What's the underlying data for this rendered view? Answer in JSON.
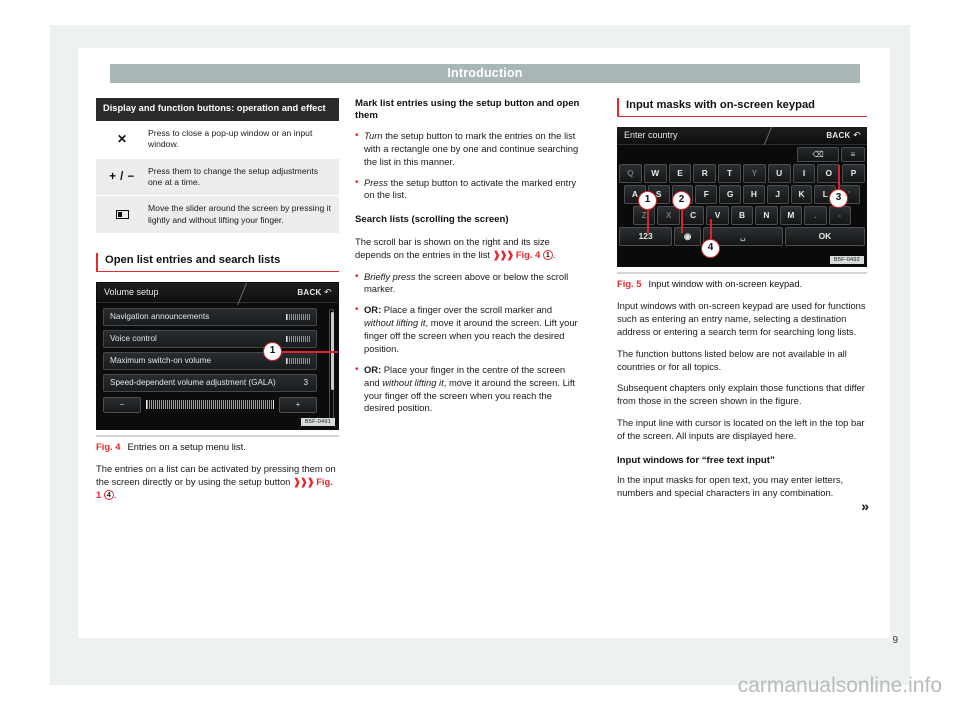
{
  "header": {
    "title": "Introduction"
  },
  "page": {
    "number": "9",
    "watermark": "carmanualsonline.info",
    "more_indicator": "»"
  },
  "col1": {
    "table": {
      "header": "Display and function buttons: operation and effect",
      "rows": [
        {
          "icon": "close-x-icon",
          "glyph": "✕",
          "text": "Press to close a pop-up window or an input window."
        },
        {
          "icon": "plus-minus-icon",
          "glyph": "+ / −",
          "text": "Press them to change the setup adjustments one at a time."
        },
        {
          "icon": "slider-icon",
          "glyph": "slider",
          "text": "Move the slider around the screen by pressing it lightly and without lifting your finger."
        }
      ]
    },
    "section_heading": "Open list entries and search lists",
    "figure": {
      "label": "Fig. 4",
      "caption": "Entries on a setup menu list.",
      "code": "B5F-0491",
      "screen": {
        "title": "Volume setup",
        "back": "BACK",
        "items": [
          {
            "label": "Navigation announcements",
            "value": ""
          },
          {
            "label": "Voice control",
            "value": ""
          },
          {
            "label": "Maximum switch-on volume",
            "value": ""
          },
          {
            "label": "Speed-dependent volume adjustment (GALA)",
            "value": "3"
          }
        ],
        "minus_button": "−",
        "plus_button": "+",
        "callout": "1"
      }
    },
    "paragraph": "The entries on a list can be activated by pressing them on the screen directly or by using the setup button ",
    "paragraph_xref": "Fig. 1",
    "paragraph_ref_num": "4",
    "paragraph_end": "."
  },
  "col2": {
    "heading_1": "Mark list entries using the setup button and open them",
    "bullets_1": [
      {
        "lead": "Turn",
        "lead_style": "italic",
        "rest": " the setup button to mark the entries on the list with a rectangle one by one and continue searching the list in this manner."
      },
      {
        "lead": "Press",
        "lead_style": "italic",
        "rest": " the setup button to activate the marked entry on the list."
      }
    ],
    "heading_2": "Search lists (scrolling the screen)",
    "paragraph_1": "The scroll bar is shown on the right and its size depends on the entries in the list ",
    "paragraph_1_xref": "Fig. 4",
    "paragraph_1_ref_num": "1",
    "paragraph_1_end": ".",
    "bullets_2": [
      {
        "lead": "Briefly press",
        "lead_style": "italic",
        "rest": " the screen above or below the scroll marker."
      },
      {
        "lead": "OR:",
        "lead_style": "bold",
        "rest_a": " Place a finger over the scroll marker and ",
        "rest_italic": "without lifting it",
        "rest_b": ", move it around the screen. Lift your finger off the screen when you reach the desired position."
      },
      {
        "lead": "OR:",
        "lead_style": "bold",
        "rest_a": " Place your finger in the centre of the screen and ",
        "rest_italic": "without lifting it",
        "rest_b": ", move it around the screen. Lift your finger off the screen when you reach the desired position."
      }
    ]
  },
  "col3": {
    "section_heading": "Input masks with on-screen keypad",
    "figure": {
      "label": "Fig. 5",
      "caption": "Input window with on-screen keypad.",
      "code": "B5F-0492",
      "screen": {
        "title": "Enter country",
        "back": "BACK",
        "backspace_icon": "backspace-icon",
        "layout_icon": "keyboard-layout-icon",
        "row1": [
          "Q",
          "W",
          "E",
          "R",
          "T",
          "Y",
          "U",
          "I",
          "O",
          "P"
        ],
        "row2": [
          "A",
          "S",
          "D",
          "F",
          "G",
          "H",
          "J",
          "K",
          "L",
          "'"
        ],
        "row3": [
          "Z",
          "X",
          "C",
          "V",
          "B",
          "N",
          "M",
          ".",
          "-"
        ],
        "numeric_key": "123",
        "globe_key": "globe-icon",
        "space_key": "␣",
        "ok_key": "OK",
        "callouts": [
          "1",
          "2",
          "3",
          "4"
        ]
      }
    },
    "paragraphs": [
      "Input windows with on-screen keypad are used for functions such as entering an entry name, selecting a destination address or entering a search term for searching long lists.",
      "The function buttons listed below are not available in all countries or for all topics.",
      "Subsequent chapters only explain those functions that differ from those in the screen shown in the figure.",
      "The input line with cursor is located on the left in the top bar of the screen. All inputs are displayed here."
    ],
    "heading_free_text": "Input windows for “free text input”",
    "paragraph_free_text": "In the input masks for open text, you may enter letters, numbers and special characters in any combination."
  },
  "colors": {
    "accent_red": "#e8272e",
    "header_bar": "#a9b6b6",
    "page_backing": "#eef1f2",
    "table_header": "#2b2b2b"
  }
}
